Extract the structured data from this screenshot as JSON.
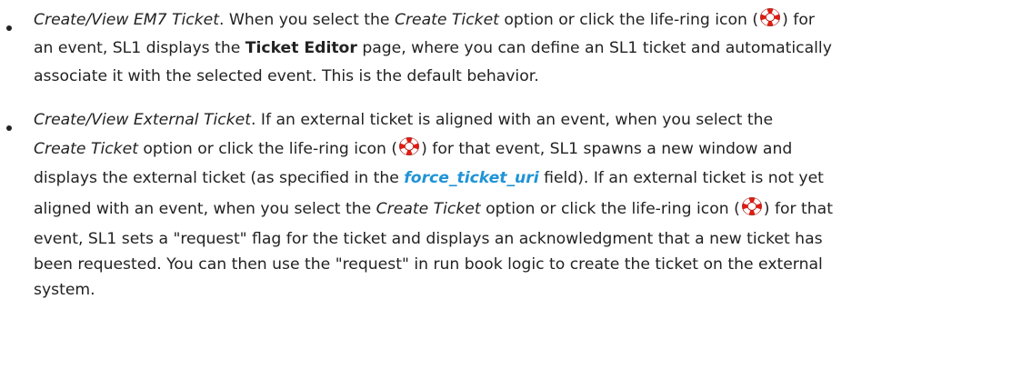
{
  "bullets": [
    {
      "lines": [
        [
          {
            "kind": "em",
            "text": "Create/View EM7 Ticket"
          },
          {
            "kind": "text",
            "text": ". When you select the "
          },
          {
            "kind": "em",
            "text": "Create Ticket"
          },
          {
            "kind": "text",
            "text": " option or click the life-ring icon ("
          },
          {
            "kind": "icon",
            "icon": "life-ring-icon"
          },
          {
            "kind": "text",
            "text": ") for"
          }
        ],
        [
          {
            "kind": "text",
            "text": "an event, SL1 displays the "
          },
          {
            "kind": "strong",
            "text": "Ticket Editor"
          },
          {
            "kind": "text",
            "text": " page, where you can define an SL1 ticket and automatically"
          }
        ],
        [
          {
            "kind": "text",
            "text": "associate it with the selected event. This is the default behavior."
          }
        ]
      ]
    },
    {
      "lines": [
        [
          {
            "kind": "em",
            "text": "Create/View External Ticket"
          },
          {
            "kind": "text",
            "text": ". If an external ticket is aligned with an event, when you select the"
          }
        ],
        [
          {
            "kind": "em",
            "text": "Create Ticket"
          },
          {
            "kind": "text",
            "text": " option or click the life-ring icon ("
          },
          {
            "kind": "icon",
            "icon": "life-ring-icon"
          },
          {
            "kind": "text",
            "text": ") for that event, SL1 spawns a new window and"
          }
        ],
        [
          {
            "kind": "text",
            "text": "displays the external ticket (as specified in the "
          },
          {
            "kind": "link",
            "text": "force_ticket_uri"
          },
          {
            "kind": "text",
            "text": " field). If an external ticket is not yet"
          }
        ],
        [
          {
            "kind": "text",
            "text": "aligned with an event, when you select the "
          },
          {
            "kind": "em",
            "text": "Create Ticket"
          },
          {
            "kind": "text",
            "text": " option or click the life-ring icon ("
          },
          {
            "kind": "icon",
            "icon": "life-ring-icon"
          },
          {
            "kind": "text",
            "text": ") for that"
          }
        ],
        [
          {
            "kind": "text",
            "text": "event, SL1 sets a \"request\" flag for the ticket and displays an acknowledgment that a new ticket has"
          }
        ],
        [
          {
            "kind": "text",
            "text": "been requested. You can then use the \"request\" in run book logic to create the ticket on the external"
          }
        ],
        [
          {
            "kind": "text",
            "text": "system."
          }
        ]
      ]
    }
  ],
  "colors": {
    "text": "#222222",
    "link": "#1f93d6",
    "ring_red": "#e21b12",
    "ring_white": "#ffffff"
  }
}
